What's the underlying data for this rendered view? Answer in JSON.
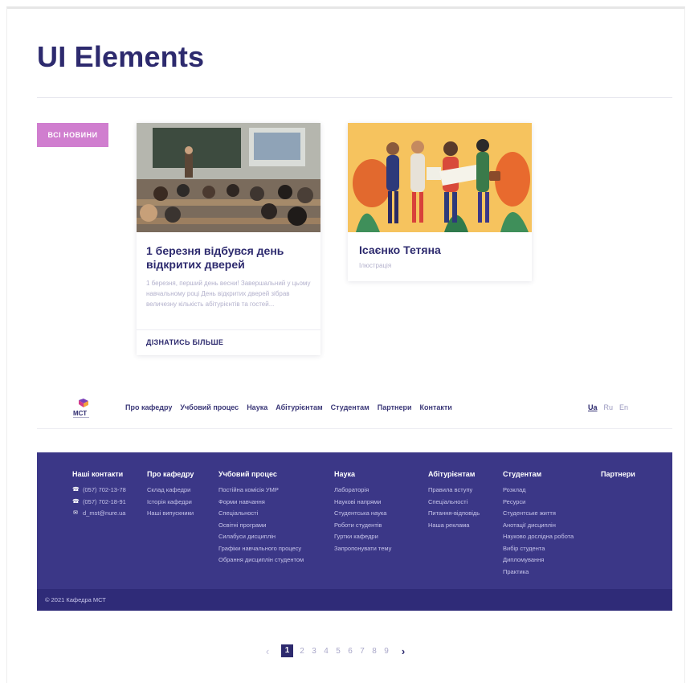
{
  "page": {
    "title": "UI Elements"
  },
  "all_news_button": "ВСІ НОВИНИ",
  "cards": [
    {
      "title": "1 березня відбувся день відкритих дверей",
      "excerpt": "1 березня, перший день весни! Завершальний у цьому навчальному році День відкритих дверей зібрав величезну кількість абітурієнтів та гостей...",
      "more_link": "ДІЗНАТИСЬ БІЛЬШЕ",
      "image_icon": "lecture-photo"
    },
    {
      "title": "Ісаєнко Тетяна",
      "subtitle": "Ілюстрація",
      "image_icon": "people-illustration"
    }
  ],
  "nav": {
    "logo_text": "МСТ",
    "links": [
      "Про кафедру",
      "Учбовий процес",
      "Наука",
      "Абітурієнтам",
      "Студентам",
      "Партнери",
      "Контакти"
    ],
    "languages": [
      "Ua",
      "Ru",
      "En"
    ],
    "active_language": "Ua"
  },
  "footer": {
    "contacts": {
      "heading": "Наші контакти",
      "items": [
        {
          "icon": "phone-icon",
          "text": "(057) 702-13-78"
        },
        {
          "icon": "phone-icon",
          "text": "(057) 702-18-91"
        },
        {
          "icon": "mail-icon",
          "text": "d_mst@nure.ua"
        }
      ]
    },
    "columns": [
      {
        "heading": "Про кафедру",
        "items": [
          "Склад кафедри",
          "Історія кафедри",
          "Наші випускники"
        ]
      },
      {
        "heading": "Учбовий процес",
        "items": [
          "Постійна комісія УМР",
          "Форми навчання",
          "Спеціальності",
          "Освітні програми",
          "Силабуси дисциплін",
          "Графіки навчального процесу",
          "Обрання дисциплін студентом"
        ]
      },
      {
        "heading": "Наука",
        "items": [
          "Лабораторія",
          "Наукові напрями",
          "Студентська наука",
          "Роботи студентів",
          "Гуртки кафедри",
          "Запропонувати тему"
        ]
      },
      {
        "heading": "Абітурієнтам",
        "items": [
          "Правила вступу",
          "Спеціальності",
          "Питання-відповідь",
          "Наша реклама"
        ]
      },
      {
        "heading": "Студентам",
        "items": [
          "Розклад",
          "Ресурси",
          "Студентське життя",
          "Анотації дисциплін",
          "Науково дослідна робота",
          "Вибір студента",
          "Дипломування",
          "Практика"
        ]
      },
      {
        "heading": "Партнери",
        "items": []
      }
    ],
    "copyright": "© 2021 Кафедра МСТ"
  },
  "pagination": {
    "prev": "‹",
    "pages": [
      "1",
      "2",
      "3",
      "4",
      "5",
      "6",
      "7",
      "8",
      "9"
    ],
    "current": "1",
    "next": "›"
  },
  "colors": {
    "primary": "#2d2a6e",
    "accent_pink": "#d07ecf",
    "footer_bg": "#3b3787",
    "footer_bottom_bg": "#2f2b78",
    "illustration_bg": "#f6c35e"
  }
}
